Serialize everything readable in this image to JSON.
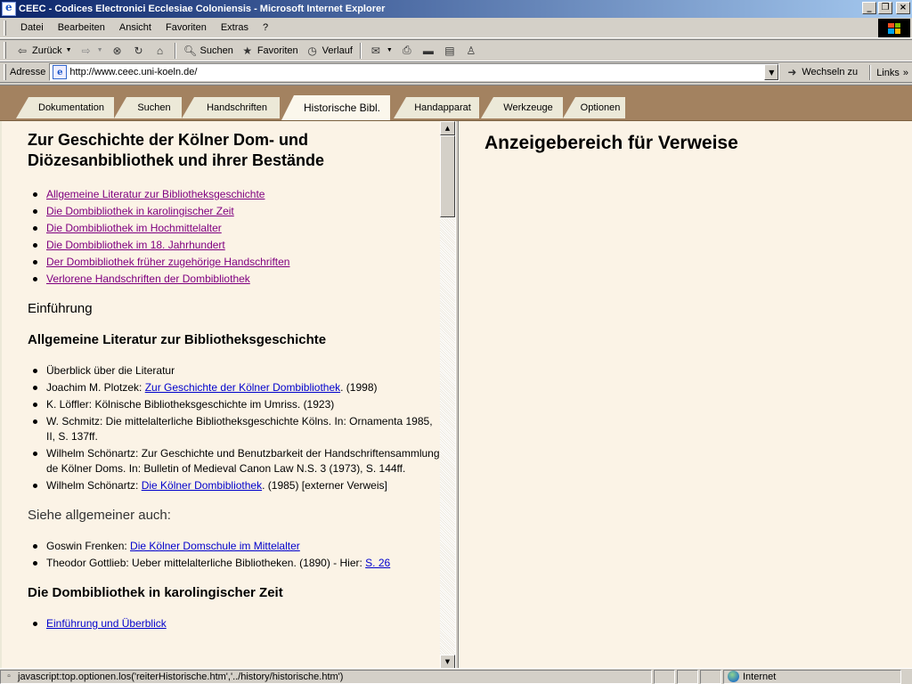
{
  "window": {
    "title": "CEEC - Codices Electronici Ecclesiae Coloniensis - Microsoft Internet Explorer"
  },
  "menu": [
    "Datei",
    "Bearbeiten",
    "Ansicht",
    "Favoriten",
    "Extras",
    "?"
  ],
  "toolbar": {
    "back": "Zurück",
    "search": "Suchen",
    "favorites": "Favoriten",
    "history": "Verlauf"
  },
  "address": {
    "label": "Adresse",
    "url": "http://www.ceec.uni-koeln.de/",
    "go": "Wechseln zu",
    "links": "Links"
  },
  "tabs": [
    {
      "label": "Dokumentation"
    },
    {
      "label": "Suchen"
    },
    {
      "label": "Handschriften"
    },
    {
      "label": "Historische Bibl."
    },
    {
      "label": "Handapparat"
    },
    {
      "label": "Werkzeuge"
    },
    {
      "label": "Optionen"
    }
  ],
  "left": {
    "title": "Zur Geschichte der Kölner Dom- und Diözesanbibliothek und ihrer Bestände",
    "toc": [
      "Allgemeine Literatur zur Bibliotheksgeschichte",
      "Die Dombibliothek in karolingischer Zeit",
      "Die Dombibliothek im Hochmittelalter",
      "Die Dombibliothek im 18. Jahrhundert",
      "Der Dombibliothek früher zugehörige Handschriften",
      "Verlorene Handschriften der Dombibliothek"
    ],
    "intro_heading": "Einführung",
    "lit_heading": "Allgemeine Literatur zur Bibliotheksgeschichte",
    "lit": {
      "i1": "Überblick über die Literatur",
      "i2_pre": "Joachim M. Plotzek: ",
      "i2_link": "Zur Geschichte der Kölner Dombibliothek",
      "i2_post": ". (1998)",
      "i3": "K. Löffler: Kölnische Bibliotheksgeschichte im Umriss. (1923)",
      "i4": "W. Schmitz: Die mittelalterliche Bibliotheksgeschichte Kölns. In: Ornamenta 1985, II, S. 137ff.",
      "i5": "Wilhelm Schönartz: Zur Geschichte und Benutzbarkeit der Handschriftensammlung de Kölner Doms. In: Bulletin of Medieval Canon Law N.S. 3 (1973), S. 144ff.",
      "i6_pre": "Wilhelm Schönartz: ",
      "i6_link": "Die Kölner Dombibliothek",
      "i6_post": ". (1985) [externer Verweis]"
    },
    "see_also_heading": "Siehe allgemeiner auch:",
    "see": {
      "i1_pre": "Goswin Frenken: ",
      "i1_link": "Die Kölner Domschule im Mittelalter",
      "i2_pre": "Theodor Gottlieb: Ueber mittelalterliche Bibliotheken. (1890) - Hier: ",
      "i2_link": "S. 26"
    },
    "karol_heading": "Die Dombibliothek in karolingischer Zeit",
    "karol_first": "Einführung und Überblick"
  },
  "right": {
    "title": "Anzeigebereich für Verweise"
  },
  "status": {
    "text": "javascript:top.optionen.los('reiterHistorische.htm','../history/historische.htm')",
    "zone": "Internet"
  },
  "colors": {
    "tabbar": "#a38260",
    "content_bg": "#fbf3e6",
    "link": "#0000cc",
    "visited": "#800080"
  }
}
